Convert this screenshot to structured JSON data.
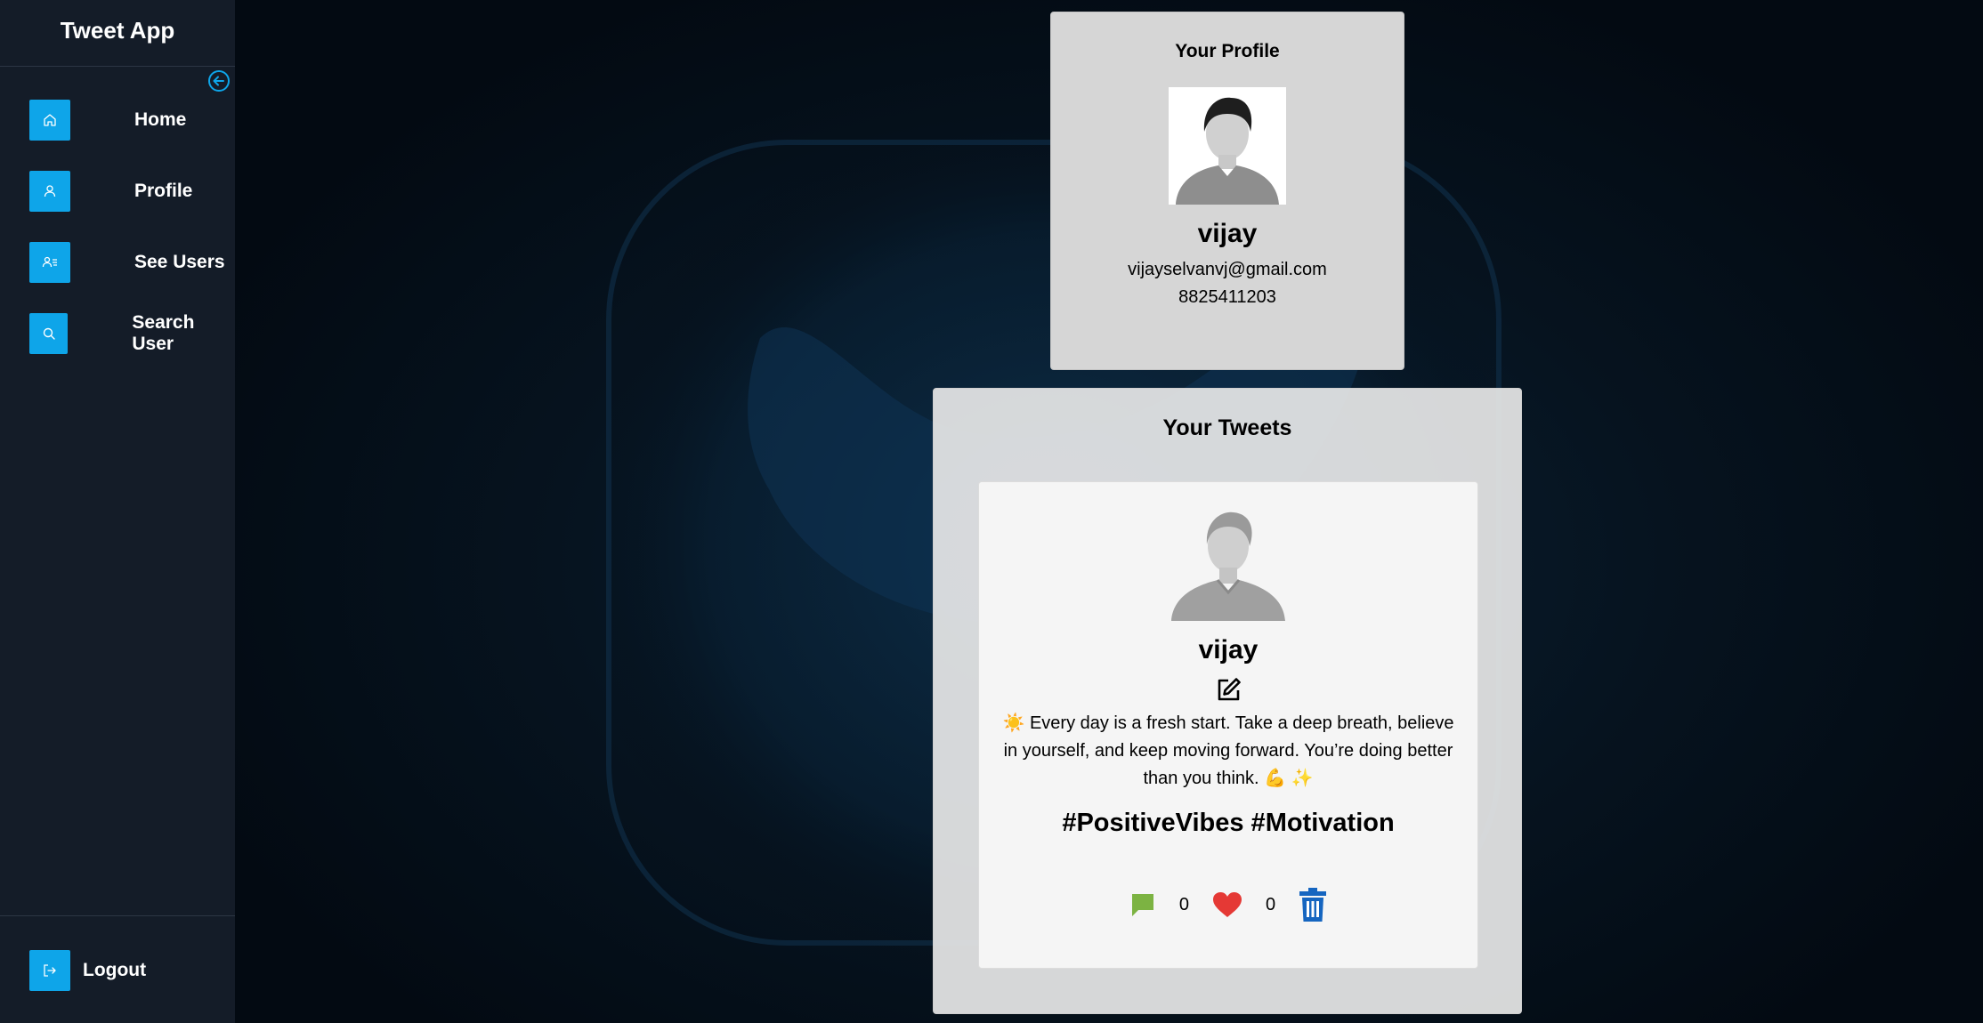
{
  "app": {
    "title": "Tweet App"
  },
  "sidebar": {
    "items": [
      {
        "label": "Home",
        "icon": "home-icon"
      },
      {
        "label": "Profile",
        "icon": "user-icon"
      },
      {
        "label": "See Users",
        "icon": "users-list-icon"
      },
      {
        "label": "Search User",
        "icon": "search-icon"
      }
    ],
    "logout_label": "Logout",
    "accent": "#0ea5e9"
  },
  "profile": {
    "title": "Your Profile",
    "name": "vijay",
    "email": "vijayselvanvj@gmail.com",
    "phone": "8825411203"
  },
  "tweets": {
    "title": "Your Tweets",
    "items": [
      {
        "user": "vijay",
        "text": "☀️ Every day is a fresh start. Take a deep breath, believe in yourself, and keep moving forward. You’re doing better than you think. 💪 ✨",
        "tags": "#PositiveVibes #Motivation",
        "comments": "0",
        "likes": "0"
      }
    ]
  }
}
